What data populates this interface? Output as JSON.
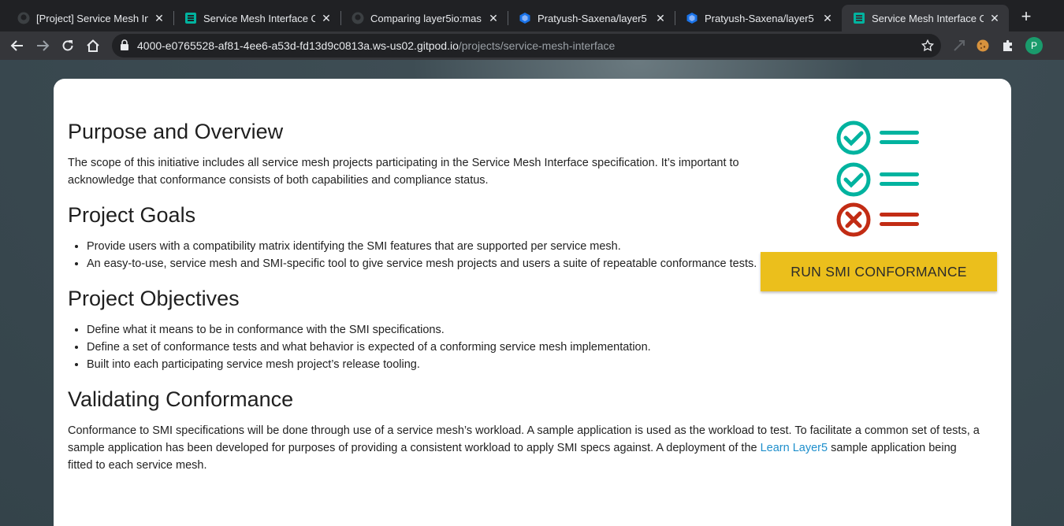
{
  "browser": {
    "tabs": [
      {
        "title": "[Project] Service Mesh In",
        "favicon": "github-icon"
      },
      {
        "title": "Service Mesh Interface C",
        "favicon": "layer5-icon"
      },
      {
        "title": "Comparing layer5io:mas",
        "favicon": "github-icon"
      },
      {
        "title": "Pratyush-Saxena/layer5",
        "favicon": "gitpod-icon"
      },
      {
        "title": "Pratyush-Saxena/layer5",
        "favicon": "gitpod-icon"
      },
      {
        "title": "Service Mesh Interface C",
        "favicon": "layer5-icon"
      }
    ],
    "active_tab": 5,
    "close_glyph": "✕",
    "new_tab_glyph": "+",
    "url_host": "4000-e0765528-af81-4ee6-a53d-fd13d9c0813a.ws-us02.gitpod.io",
    "url_path": "/projects/service-mesh-interface",
    "profile_initial": "P",
    "colors": {
      "tab_strip": "#202124",
      "toolbar": "#35363a",
      "profile": "#1a9b6c"
    }
  },
  "page": {
    "section1": {
      "heading": "Purpose and Overview",
      "text": "The scope of this initiative includes all service mesh projects participating in the Service Mesh Interface specification. It’s important to acknowledge that conformance consists of both capabilities and compliance status."
    },
    "section2": {
      "heading": "Project Goals",
      "items": [
        "Provide users with a compatibility matrix identifying the SMI features that are supported per service mesh.",
        "An easy-to-use, service mesh and SMI-specific tool to give service mesh projects and users a suite of repeatable conformance tests."
      ]
    },
    "section3": {
      "heading": "Project Objectives",
      "items": [
        "Define what it means to be in conformance with the SMI specifications.",
        "Define a set of conformance tests and what behavior is expected of a conforming service mesh implementation.",
        "Built into each participating service mesh project’s release tooling."
      ]
    },
    "section4": {
      "heading": "Validating Conformance",
      "text_before_link": "Conformance to SMI specifications will be done through use of a service mesh’s workload. A sample application is used as the workload to test. To facilitate a common set of tests, a sample application has been developed for purposes of providing a consistent workload to apply SMI specs against. A deployment of the ",
      "link_text": "Learn Layer5",
      "text_after_link": " sample application being fitted to each service mesh."
    },
    "run_button_label": "RUN SMI CONFORMANCE",
    "colors": {
      "check": "#00b39f",
      "cross": "#c22c14",
      "button": "#ebbf1c",
      "link": "#1e8fcc"
    }
  }
}
